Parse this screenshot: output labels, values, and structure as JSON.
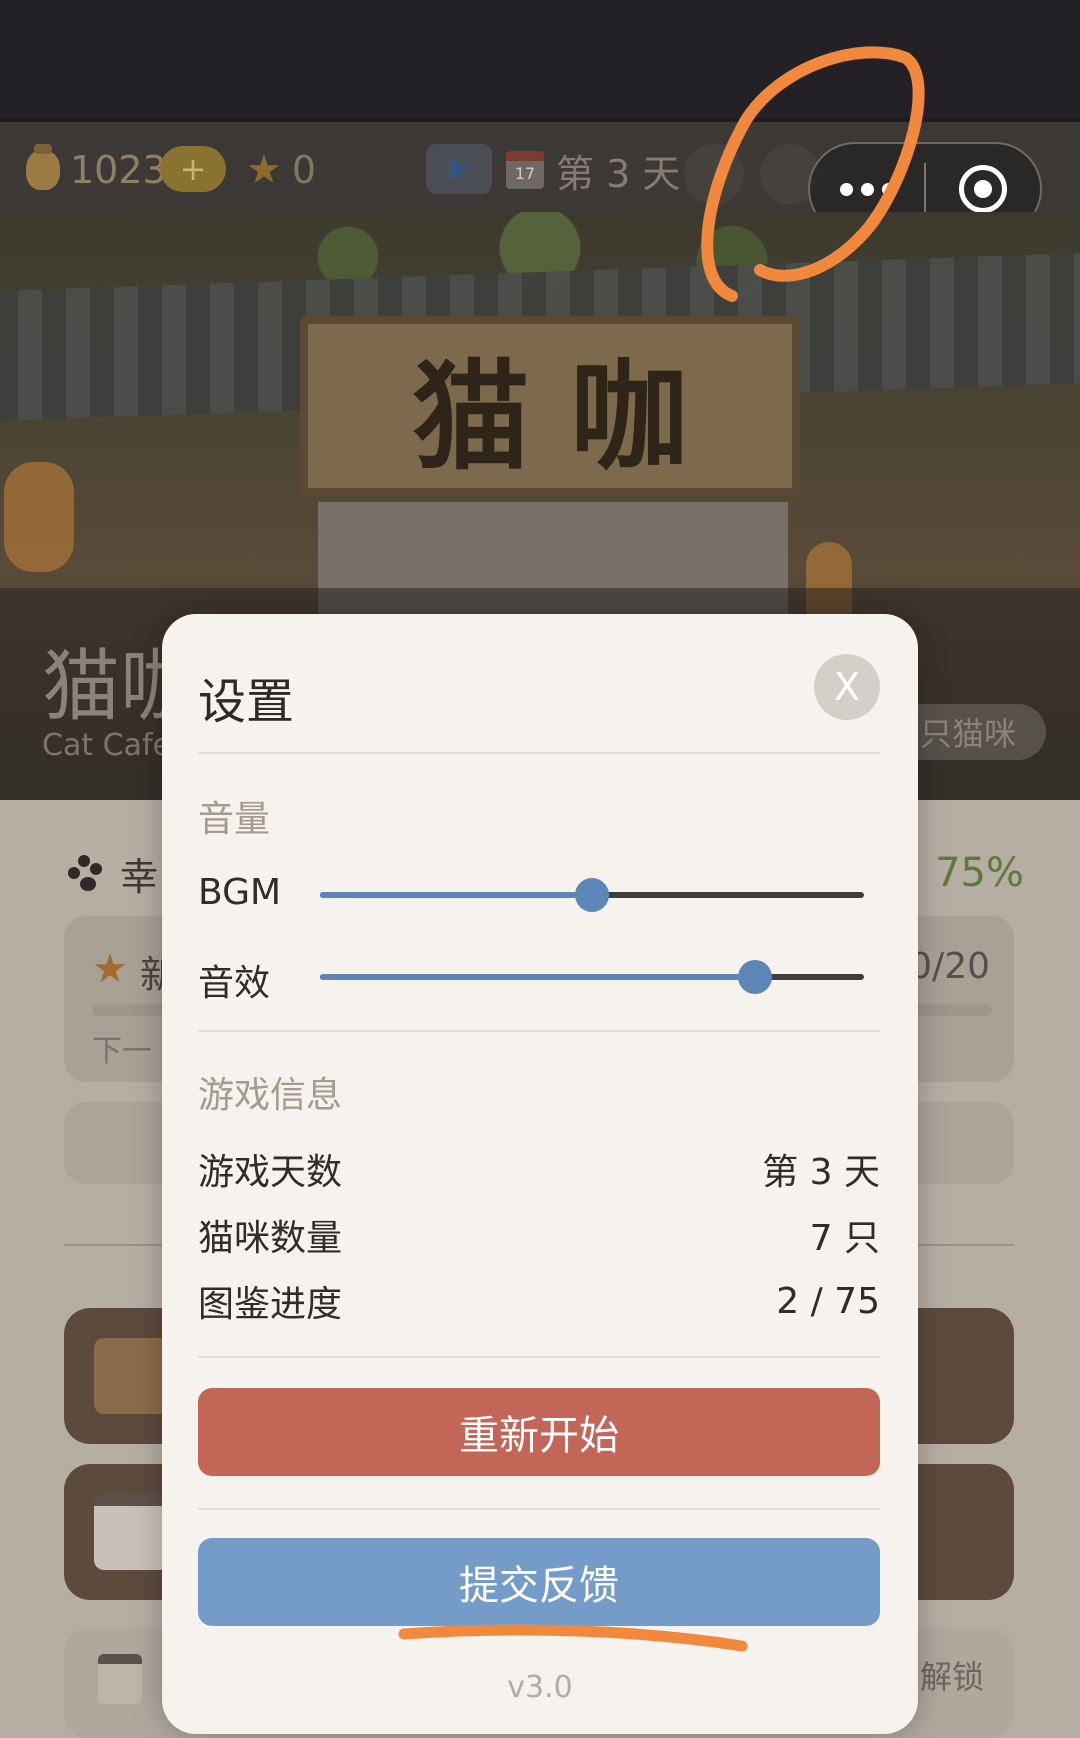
{
  "topbar": {
    "coins": "1023",
    "plus_label": "+",
    "stars": "0",
    "calendar_label": "17",
    "day_label": "第 3 天"
  },
  "banner": {
    "sign_chars": [
      "猫",
      "咖"
    ],
    "title": "猫咖",
    "subtitle": "Cat Cafe",
    "cat_count_label": "只猫咪"
  },
  "background": {
    "happiness_label": "幸",
    "happiness_value": "75%",
    "level_label": "新",
    "level_progress": "0/20",
    "next_label": "下一",
    "unlock_label": "解锁"
  },
  "settings": {
    "title": "设置",
    "close_label": "X",
    "volume_section": "音量",
    "bgm_label": "BGM",
    "bgm_level": 0.5,
    "sfx_label": "音效",
    "sfx_level": 0.8,
    "info_section": "游戏信息",
    "info_rows": [
      {
        "label": "游戏天数",
        "value": "第 3 天"
      },
      {
        "label": "猫咪数量",
        "value": "7 只"
      },
      {
        "label": "图鉴进度",
        "value": "2 / 75"
      }
    ],
    "restart_label": "重新开始",
    "feedback_label": "提交反馈",
    "version": "v3.0"
  },
  "colors": {
    "accent_blue": "#759bc9",
    "danger_red": "#c36557",
    "annotation_orange": "#f0883e"
  }
}
